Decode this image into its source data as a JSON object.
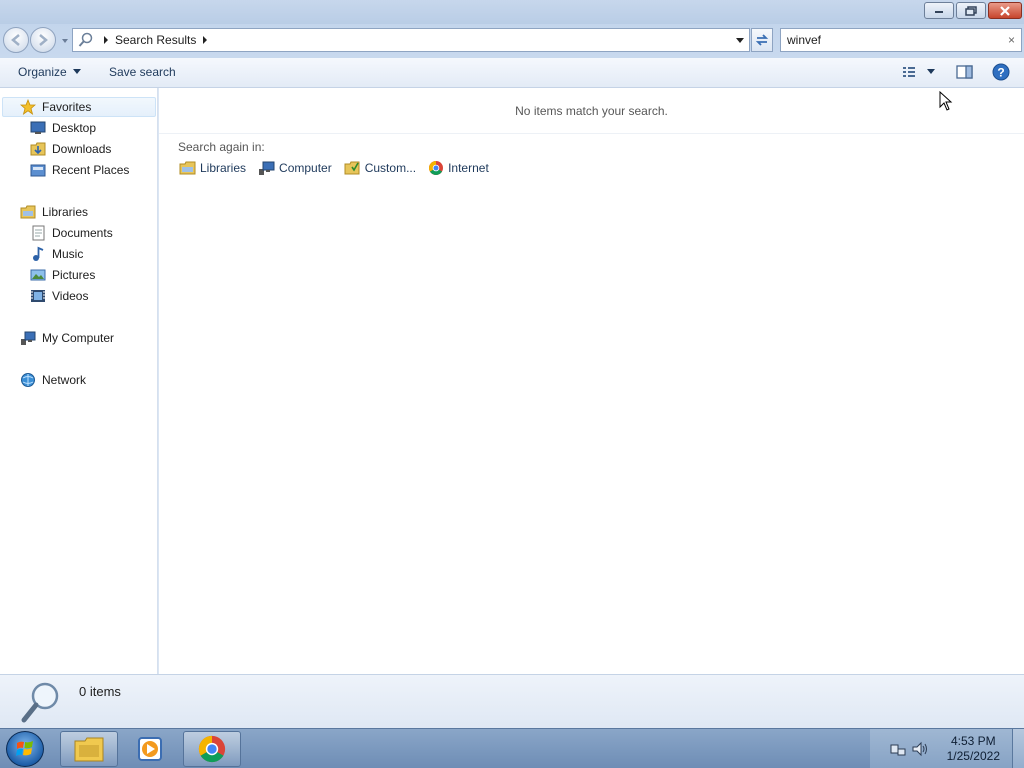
{
  "window": {
    "min_label": "minimize",
    "max_label": "restore",
    "close_label": "close"
  },
  "address": {
    "breadcrumb": "Search Results",
    "search_value": "winvef",
    "search_clear": "×"
  },
  "toolbar": {
    "organize_label": "Organize",
    "save_search_label": "Save search"
  },
  "nav": {
    "favorites": {
      "label": "Favorites",
      "items": [
        {
          "label": "Desktop",
          "icon": "desktop-icon"
        },
        {
          "label": "Downloads",
          "icon": "downloads-icon"
        },
        {
          "label": "Recent Places",
          "icon": "recent-places-icon"
        }
      ]
    },
    "libraries": {
      "label": "Libraries",
      "items": [
        {
          "label": "Documents",
          "icon": "documents-icon"
        },
        {
          "label": "Music",
          "icon": "music-icon"
        },
        {
          "label": "Pictures",
          "icon": "pictures-icon"
        },
        {
          "label": "Videos",
          "icon": "videos-icon"
        }
      ]
    },
    "computer": {
      "label": "My Computer"
    },
    "network": {
      "label": "Network"
    }
  },
  "content": {
    "message": "No items match your search.",
    "search_again_label": "Search again in:",
    "search_again": [
      {
        "label": "Libraries",
        "icon": "libraries-icon"
      },
      {
        "label": "Computer",
        "icon": "computer-icon"
      },
      {
        "label": "Custom...",
        "icon": "custom-folder-icon"
      },
      {
        "label": "Internet",
        "icon": "chrome-icon"
      }
    ]
  },
  "details": {
    "count": "0 items"
  },
  "taskbar": {
    "time": "4:53 PM",
    "date": "1/25/2022"
  },
  "colors": {
    "link": "#1e395b",
    "close_red": "#c7452c"
  }
}
